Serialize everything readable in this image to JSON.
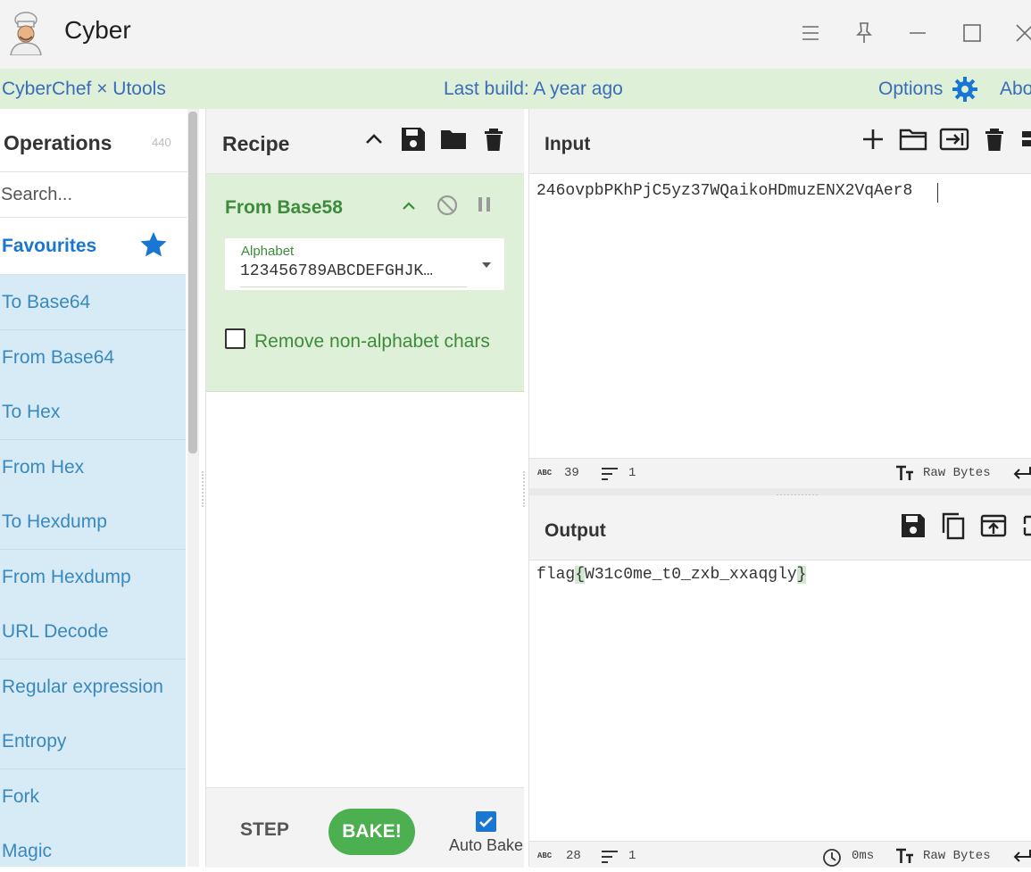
{
  "window": {
    "title": "Cyber"
  },
  "banner": {
    "left": "CyberChef × Utools",
    "center": "Last build: A year ago",
    "options": "Options",
    "about": "Abo"
  },
  "operations": {
    "title": "Operations",
    "count": "440",
    "search_placeholder": "Search...",
    "favourites": "Favourites",
    "items": [
      "To Base64",
      "From Base64",
      "To Hex",
      "From Hex",
      "To Hexdump",
      "From Hexdump",
      "URL Decode",
      "Regular expression",
      "Entropy",
      "Fork",
      "Magic"
    ]
  },
  "recipe": {
    "title": "Recipe",
    "operation": {
      "name": "From Base58",
      "alphabet_label": "Alphabet",
      "alphabet_value": "123456789ABCDEFGHJK…",
      "remove_label": "Remove non-alphabet chars",
      "remove_checked": false
    },
    "step_label": "STEP",
    "bake_label": "BAKE!",
    "autobake_label": "Auto Bake",
    "autobake_checked": true
  },
  "input": {
    "title": "Input",
    "text": "246ovpbPKhPjC5yz37WQaikoHDmuzENX2VqAer8",
    "length": "39",
    "lines": "1",
    "encoding": "Raw Bytes"
  },
  "output": {
    "title": "Output",
    "prefix": "flag",
    "open_brace": "{",
    "body": "W31c0me_t0_zxb_xxaqgly",
    "close_brace": "}",
    "length": "28",
    "lines": "1",
    "time": "0ms",
    "encoding": "Raw Bytes"
  },
  "colors": {
    "banner_bg": "#dff0d8",
    "banner_text": "#3a6cb8",
    "op_item_bg": "#d7ebf6",
    "op_item_text": "#3a88bd",
    "recipe_op_bg": "#dff0d8",
    "recipe_op_text": "#3c8c3c",
    "bake_green": "#4caf50",
    "accent_blue": "#1976d2"
  }
}
